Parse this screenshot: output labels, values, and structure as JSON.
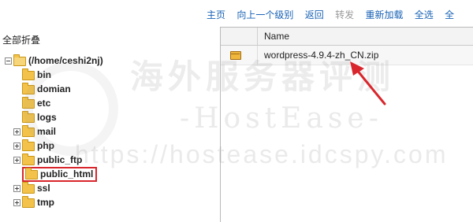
{
  "toolbar": {
    "home": "主页",
    "up_level": "向上一个级别",
    "back": "返回",
    "forward": "转发",
    "reload": "重新加载",
    "select_all": "全选",
    "cut_off": "全"
  },
  "tree": {
    "collapse_all": "全部折叠",
    "root": "(/home/ceshi2nj)",
    "items": [
      {
        "label": "bin",
        "expandable": false,
        "selected": false
      },
      {
        "label": "domian",
        "expandable": false,
        "selected": false
      },
      {
        "label": "etc",
        "expandable": false,
        "selected": false
      },
      {
        "label": "logs",
        "expandable": false,
        "selected": false
      },
      {
        "label": "mail",
        "expandable": true,
        "selected": false
      },
      {
        "label": "php",
        "expandable": true,
        "selected": false
      },
      {
        "label": "public_ftp",
        "expandable": true,
        "selected": false
      },
      {
        "label": "public_html",
        "expandable": false,
        "selected": true
      },
      {
        "label": "ssl",
        "expandable": true,
        "selected": false
      },
      {
        "label": "tmp",
        "expandable": true,
        "selected": false
      }
    ]
  },
  "file_panel": {
    "column_name": "Name",
    "files": [
      {
        "name": "wordpress-4.9.4-zh_CN.zip",
        "icon": "zip-archive-icon"
      }
    ]
  },
  "watermark": {
    "cn": "海外服务器评测",
    "en": "-HostEase-",
    "url": "https://hostease.idcspy.com"
  },
  "colors": {
    "link": "#1a63b5",
    "disabled": "#9a9a9a",
    "highlight_box": "#d9262c",
    "arrow": "#d9262c"
  }
}
